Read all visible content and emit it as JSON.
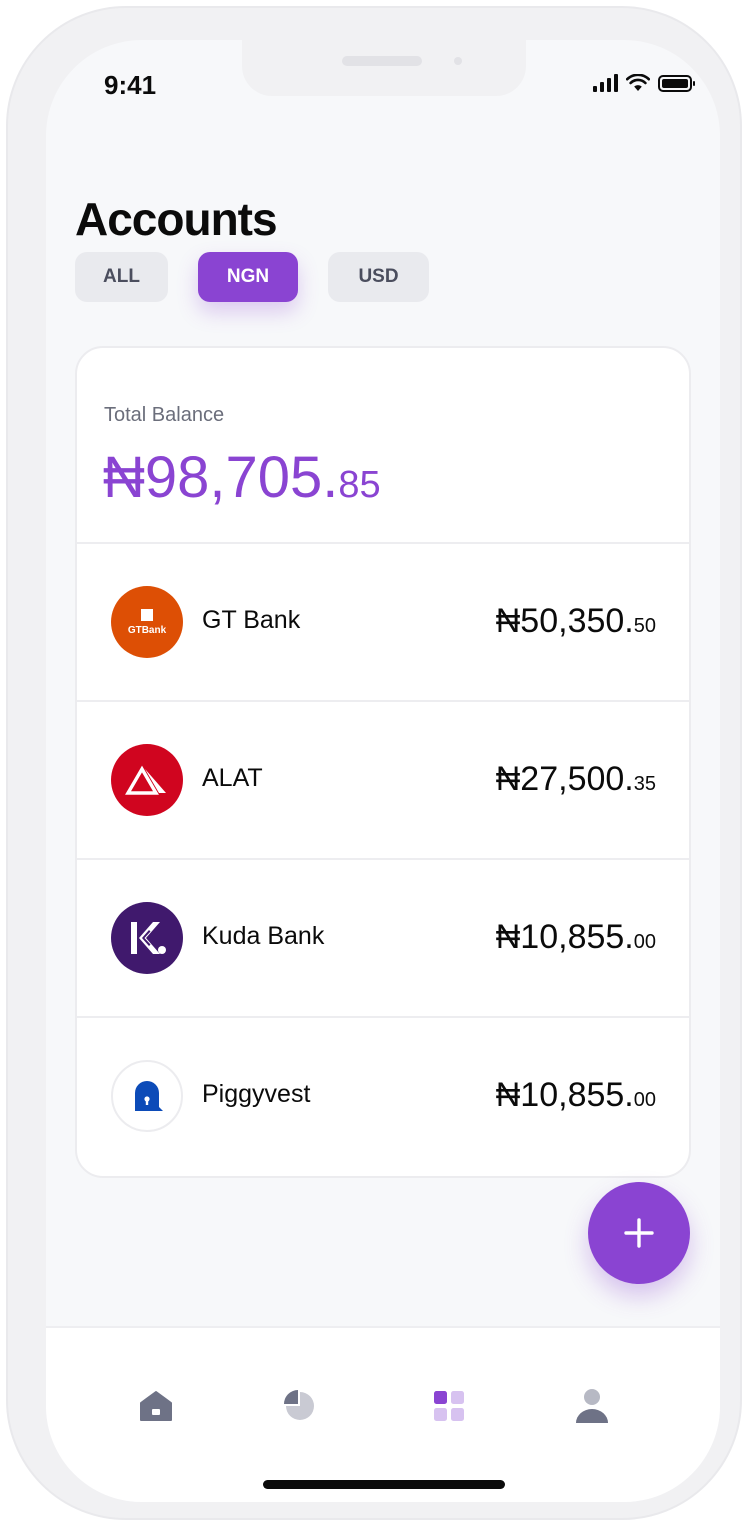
{
  "status_bar": {
    "time": "9:41",
    "icons": [
      "cellular-signal-icon",
      "wifi-icon",
      "battery-icon"
    ]
  },
  "page": {
    "title": "Accounts"
  },
  "filters": [
    {
      "label": "ALL",
      "selected": false
    },
    {
      "label": "NGN",
      "selected": true
    },
    {
      "label": "USD",
      "selected": false
    }
  ],
  "total_balance": {
    "label": "Total Balance",
    "amount_main": "₦98,705.",
    "amount_decimal": "85"
  },
  "accounts": [
    {
      "name": "GT Bank",
      "logo_text": "GTBank",
      "logo_color": "#dd4f05",
      "amount_main": "₦50,350.",
      "amount_decimal": "50"
    },
    {
      "name": "ALAT",
      "logo_color": "#d0051f",
      "amount_main": "₦27,500.",
      "amount_decimal": "35"
    },
    {
      "name": "Kuda Bank",
      "logo_color": "#40196d",
      "amount_main": "₦10,855.",
      "amount_decimal": "00"
    },
    {
      "name": "Piggyvest",
      "logo_color": "#0c4bb8",
      "amount_main": "₦10,855.",
      "amount_decimal": "00"
    }
  ],
  "fab": {
    "icon": "plus-icon"
  },
  "tab_bar": [
    {
      "icon": "home-icon",
      "active": false
    },
    {
      "icon": "pie-chart-icon",
      "active": false
    },
    {
      "icon": "grid-icon",
      "active": true
    },
    {
      "icon": "profile-icon",
      "active": false
    }
  ],
  "colors": {
    "accent": "#8a44d2",
    "background": "#f7f8fa",
    "inactive_icon": "#6e7286"
  }
}
